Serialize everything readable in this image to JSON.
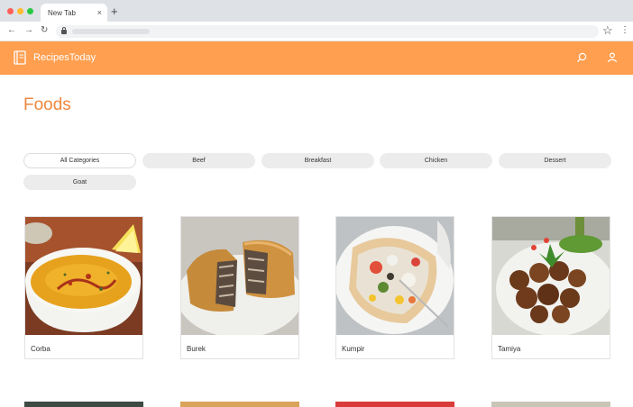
{
  "browser": {
    "tab_title": "New Tab",
    "tab_close": "×",
    "new_tab": "+",
    "back": "←",
    "forward": "→",
    "reload": "↻",
    "bookmark": "☆",
    "menu": "⋮"
  },
  "app": {
    "brand": "RecipesToday",
    "accent_color": "#ff9f4f",
    "icons": [
      "book-icon",
      "search-icon",
      "user-icon"
    ]
  },
  "page": {
    "title": "Foods"
  },
  "categories": [
    {
      "label": "All Categories",
      "active": true
    },
    {
      "label": "Beef",
      "active": false
    },
    {
      "label": "Breakfast",
      "active": false
    },
    {
      "label": "Chicken",
      "active": false
    },
    {
      "label": "Dessert",
      "active": false
    },
    {
      "label": "Goat",
      "active": false
    }
  ],
  "foods": [
    {
      "name": "Corba"
    },
    {
      "name": "Burek"
    },
    {
      "name": "Kumpir"
    },
    {
      "name": "Tamiya"
    }
  ]
}
